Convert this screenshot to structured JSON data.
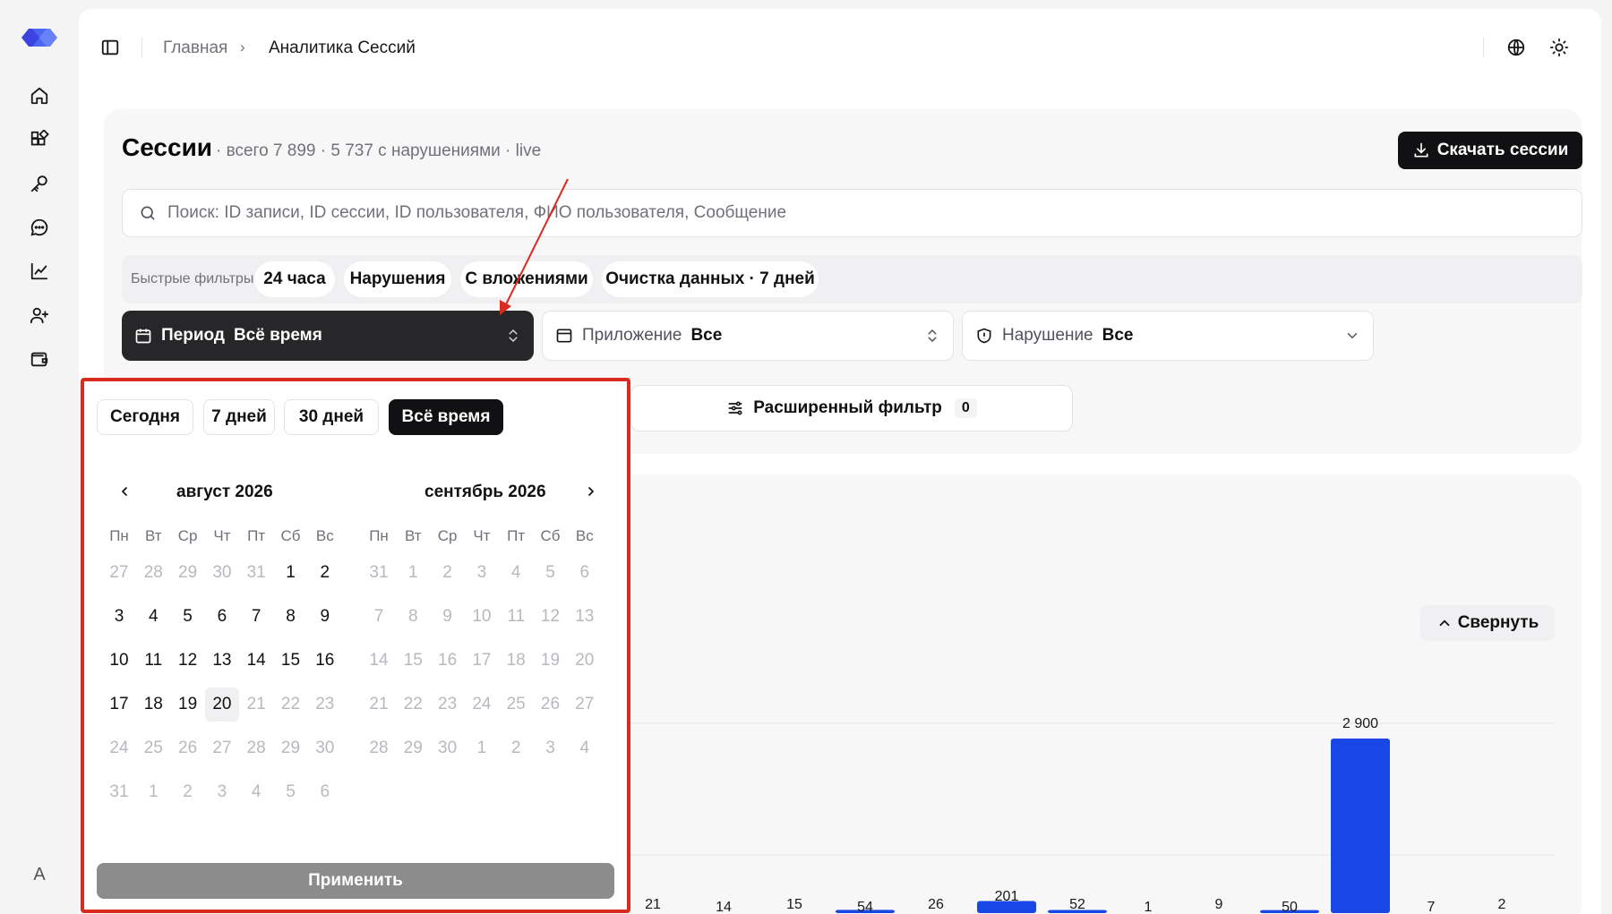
{
  "breadcrumb": {
    "home": "Главная",
    "current": "Аналитика Сессий"
  },
  "sessions": {
    "title": "Сессии",
    "subtitle": "· всего 7 899 · 5 737 с нарушениями · live",
    "download_label": "Скачать сессии",
    "search_placeholder": "Поиск: ID записи, ID сессии, ID пользователя, ФИО пользователя, Сообщение"
  },
  "quick_filters": {
    "label": "Быстрые фильтры",
    "chips": [
      "24 часа",
      "Нарушения",
      "С вложениями",
      "Очистка данных · 7 дней"
    ]
  },
  "filters": {
    "period": {
      "label": "Период",
      "value": "Всё время"
    },
    "app": {
      "label": "Приложение",
      "value": "Все"
    },
    "violation": {
      "label": "Нарушение",
      "value": "Все"
    },
    "advanced": {
      "label": "Расширенный фильтр",
      "count": "0"
    }
  },
  "date_picker": {
    "presets": [
      "Сегодня",
      "7 дней",
      "30 дней",
      "Всё время"
    ],
    "active_preset": "Всё время",
    "weekdays": [
      "Пн",
      "Вт",
      "Ср",
      "Чт",
      "Пт",
      "Сб",
      "Вс"
    ],
    "months": [
      {
        "title": "август 2026",
        "weeks": [
          [
            "27",
            "28",
            "29",
            "30",
            "31",
            "1",
            "2"
          ],
          [
            "3",
            "4",
            "5",
            "6",
            "7",
            "8",
            "9"
          ],
          [
            "10",
            "11",
            "12",
            "13",
            "14",
            "15",
            "16"
          ],
          [
            "17",
            "18",
            "19",
            "20",
            "21",
            "22",
            "23"
          ],
          [
            "24",
            "25",
            "26",
            "27",
            "28",
            "29",
            "30"
          ],
          [
            "31",
            "1",
            "2",
            "3",
            "4",
            "5",
            "6"
          ]
        ],
        "in_month": [
          [
            0,
            0,
            0,
            0,
            0,
            1,
            1
          ],
          [
            1,
            1,
            1,
            1,
            1,
            1,
            1
          ],
          [
            1,
            1,
            1,
            1,
            1,
            1,
            1
          ],
          [
            1,
            1,
            1,
            1,
            0,
            0,
            0
          ],
          [
            0,
            0,
            0,
            0,
            0,
            0,
            0
          ],
          [
            0,
            0,
            0,
            0,
            0,
            0,
            0
          ]
        ],
        "today": "20"
      },
      {
        "title": "сентябрь 2026",
        "weeks": [
          [
            "31",
            "1",
            "2",
            "3",
            "4",
            "5",
            "6"
          ],
          [
            "7",
            "8",
            "9",
            "10",
            "11",
            "12",
            "13"
          ],
          [
            "14",
            "15",
            "16",
            "17",
            "18",
            "19",
            "20"
          ],
          [
            "21",
            "22",
            "23",
            "24",
            "25",
            "26",
            "27"
          ],
          [
            "28",
            "29",
            "30",
            "1",
            "2",
            "3",
            "4"
          ]
        ],
        "in_month": [
          [
            0,
            0,
            0,
            0,
            0,
            0,
            0
          ],
          [
            0,
            0,
            0,
            0,
            0,
            0,
            0
          ],
          [
            0,
            0,
            0,
            0,
            0,
            0,
            0
          ],
          [
            0,
            0,
            0,
            0,
            0,
            0,
            0
          ],
          [
            0,
            0,
            0,
            0,
            0,
            0,
            0
          ]
        ]
      }
    ],
    "apply_label": "Применить"
  },
  "chart": {
    "collapse_label": "Свернуть",
    "accent": "#1947e5"
  },
  "chart_data": {
    "type": "bar",
    "values": [
      21,
      14,
      15,
      54,
      26,
      201,
      52,
      1,
      9,
      50,
      2900,
      7,
      2
    ],
    "value_labels": [
      "21",
      "14",
      "15",
      "54",
      "26",
      "201",
      "52",
      "1",
      "9",
      "50",
      "2 900",
      "7",
      "2"
    ]
  },
  "colors": {
    "dark": "#111113",
    "annotation": "#d92b1f"
  },
  "avatar_letter": "A"
}
